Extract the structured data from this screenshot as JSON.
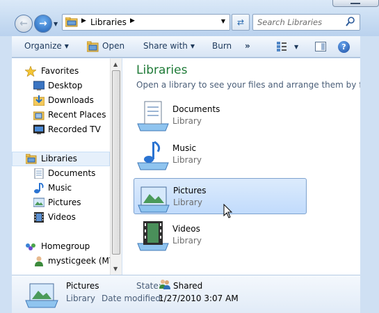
{
  "address_bar": {
    "crumbs": [
      "Libraries"
    ]
  },
  "search": {
    "placeholder": "Search Libraries"
  },
  "toolbar": {
    "organize": "Organize",
    "open": "Open",
    "share_with": "Share with",
    "burn": "Burn",
    "overflow": "»"
  },
  "nav": {
    "favorites": {
      "label": "Favorites",
      "items": [
        "Desktop",
        "Downloads",
        "Recent Places",
        "Recorded TV"
      ]
    },
    "libraries": {
      "label": "Libraries",
      "items": [
        "Documents",
        "Music",
        "Pictures",
        "Videos"
      ]
    },
    "homegroup": {
      "label": "Homegroup",
      "items": [
        "mysticgeek (MYS"
      ]
    }
  },
  "content": {
    "title": "Libraries",
    "subtitle": "Open a library to see your files and arrange them by fo...",
    "libraries": [
      {
        "name": "Documents",
        "type": "Library"
      },
      {
        "name": "Music",
        "type": "Library"
      },
      {
        "name": "Pictures",
        "type": "Library",
        "selected": true
      },
      {
        "name": "Videos",
        "type": "Library"
      }
    ]
  },
  "details": {
    "name": "Pictures",
    "type": "Library",
    "state_label": "State:",
    "state_value": "Shared",
    "modified_label": "Date modified:",
    "modified_value": "1/27/2010 3:07 AM"
  },
  "colors": {
    "title_green": "#1e7a37",
    "selection": "#c1dbfc",
    "chrome": "#cfe0f3"
  }
}
